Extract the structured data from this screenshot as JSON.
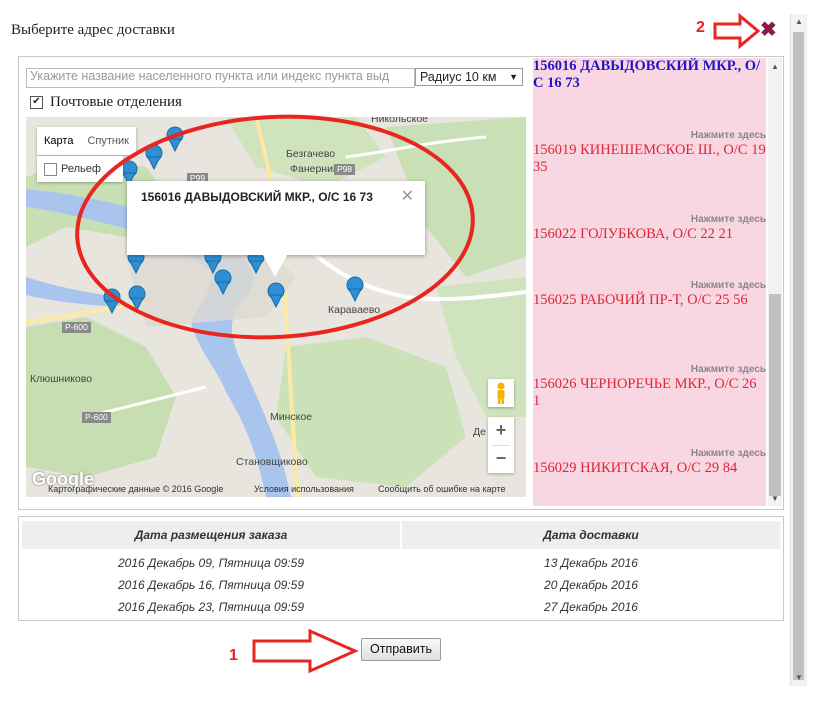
{
  "dialog": {
    "title": "Выберите адрес доставки",
    "close_glyph": "✖"
  },
  "annotations": {
    "num1": "1",
    "num2": "2"
  },
  "search": {
    "placeholder": "Укажите название населенного пункта или индекс пункта выд",
    "radius_selected": "Радиус 10 км",
    "postal_checkbox_label": "Почтовые отделения",
    "postal_checked": true
  },
  "map": {
    "type_tabs": [
      "Карта",
      "Спутник"
    ],
    "relief_label": "Рельеф",
    "infowindow_text": "156016 ДАВЫДОВСКИЙ МКР., О/С 16 73",
    "infowindow_close": "✕",
    "places": [
      "Никольское",
      "Безгачево",
      "Фанерник",
      "Караваево",
      "Клюшниково",
      "Минское",
      "Становщиково",
      "Де"
    ],
    "roads": [
      "P99",
      "P98",
      "P-600",
      "P-600"
    ],
    "logo": "Google",
    "attribution": [
      "Картографические данные © 2016 Google",
      "Условия использования",
      "Сообщить об ошибке на карте"
    ],
    "zoom_in": "+",
    "zoom_out": "−"
  },
  "addresses": [
    {
      "text": "156016 ДАВЫДОВСКИЙ МКР., О/С 16 73",
      "selected": true
    },
    {
      "text": "156019 КИНЕШЕМСКОЕ Ш., О/С 19 35",
      "selected": false
    },
    {
      "text": "156022 ГОЛУБКОВА, О/С 22 21",
      "selected": false
    },
    {
      "text": "156025 РАБОЧИЙ ПР-Т, О/С 25 56",
      "selected": false
    },
    {
      "text": "156026 ЧЕРНОРЕЧЬЕ МКР., О/С 26 1",
      "selected": false
    },
    {
      "text": "156029 НИКИТСКАЯ, О/С 29 84",
      "selected": false
    }
  ],
  "address_hint": "Нажмите здесь",
  "table": {
    "headers": [
      "Дата размещения заказа",
      "Дата доставки"
    ],
    "rows": [
      [
        "2016 Декабрь 09, Пятница 09:59",
        "13 Декабрь 2016"
      ],
      [
        "2016 Декабрь 16, Пятница 09:59",
        "20 Декабрь 2016"
      ],
      [
        "2016 Декабрь 23, Пятница 09:59",
        "27 Декабрь 2016"
      ]
    ]
  },
  "submit_label": "Отправить",
  "colors": {
    "selected_address": "#2213c6",
    "address": "#e02535",
    "address_panel_bg": "#f9d7e2",
    "annotation_red": "#e8261f",
    "close_icon": "#8b1a4b"
  }
}
